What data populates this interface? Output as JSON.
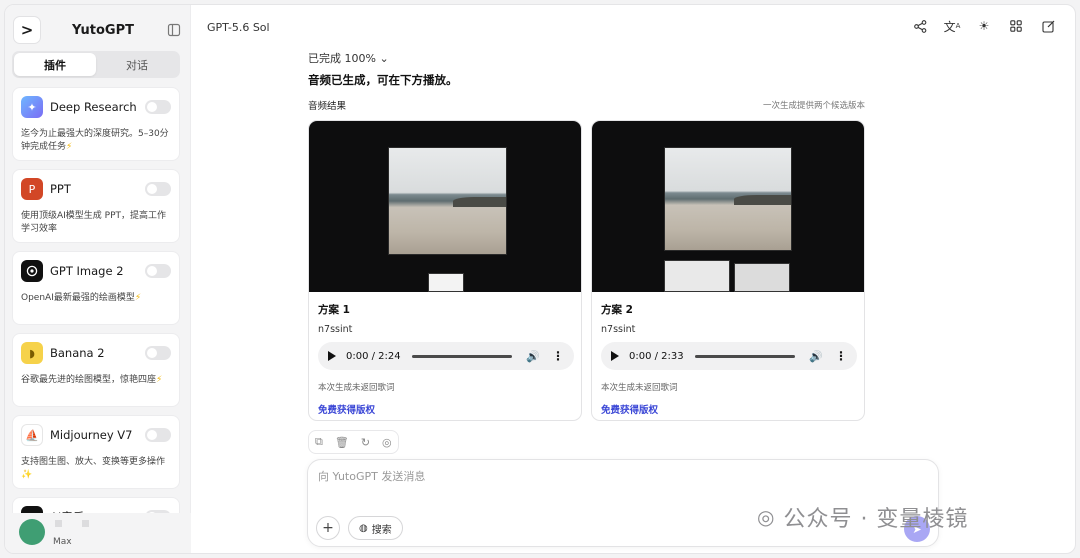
{
  "sidebar": {
    "brand_logo": ">",
    "brand_name": "YutoGPT",
    "tabs": [
      {
        "label": "插件",
        "active": true
      },
      {
        "label": "对话",
        "active": false
      }
    ],
    "plugins": [
      {
        "name": "Deep Research",
        "icon": "deep-research-icon",
        "description": "迄今为止最强大的深度研究。5–30分钟完成任务",
        "bolt": "⚡",
        "enabled": false
      },
      {
        "name": "PPT",
        "icon": "ppt-icon",
        "description": "使用顶级AI模型生成 PPT，提高工作学习效率",
        "bolt": "",
        "enabled": false
      },
      {
        "name": "GPT Image 2",
        "icon": "openai-icon",
        "description": "OpenAI最新最强的绘画模型",
        "bolt": "⚡",
        "enabled": false
      },
      {
        "name": "Banana 2",
        "icon": "banana-icon",
        "description": "谷歌最先进的绘图模型，惊艳四座",
        "bolt": "⚡",
        "enabled": false
      },
      {
        "name": "Midjourney V7",
        "icon": "midjourney-icon",
        "description": "支持图生图、放大、变换等更多操作",
        "bolt": "✨",
        "enabled": false
      },
      {
        "name": "AI音乐",
        "icon": "music-icon",
        "description": "",
        "bolt": "",
        "enabled": false
      }
    ],
    "user_plan": "Max"
  },
  "header": {
    "model": "GPT-5.6 Sol"
  },
  "main": {
    "status": "已完成 100%",
    "summary": "音频已生成，可在下方播放。",
    "results_label": "音频结果",
    "results_note": "一次生成提供两个候选版本",
    "cards": [
      {
        "title": "方案 1",
        "subtitle": "n7ssint",
        "time": "0:00 / 2:24",
        "note": "本次生成未返回歌词",
        "link": "免费获得版权"
      },
      {
        "title": "方案 2",
        "subtitle": "n7ssint",
        "time": "0:00 / 2:33",
        "note": "本次生成未返回歌词",
        "link": "免费获得版权"
      }
    ]
  },
  "composer": {
    "placeholder": "向 YutoGPT 发送消息",
    "search_label": "搜索"
  },
  "watermark": "公众号 · 变量棱镜",
  "colors": {
    "accent": "#a9a7f4",
    "link": "#3b47d6",
    "avatar": "#3f9e73"
  }
}
